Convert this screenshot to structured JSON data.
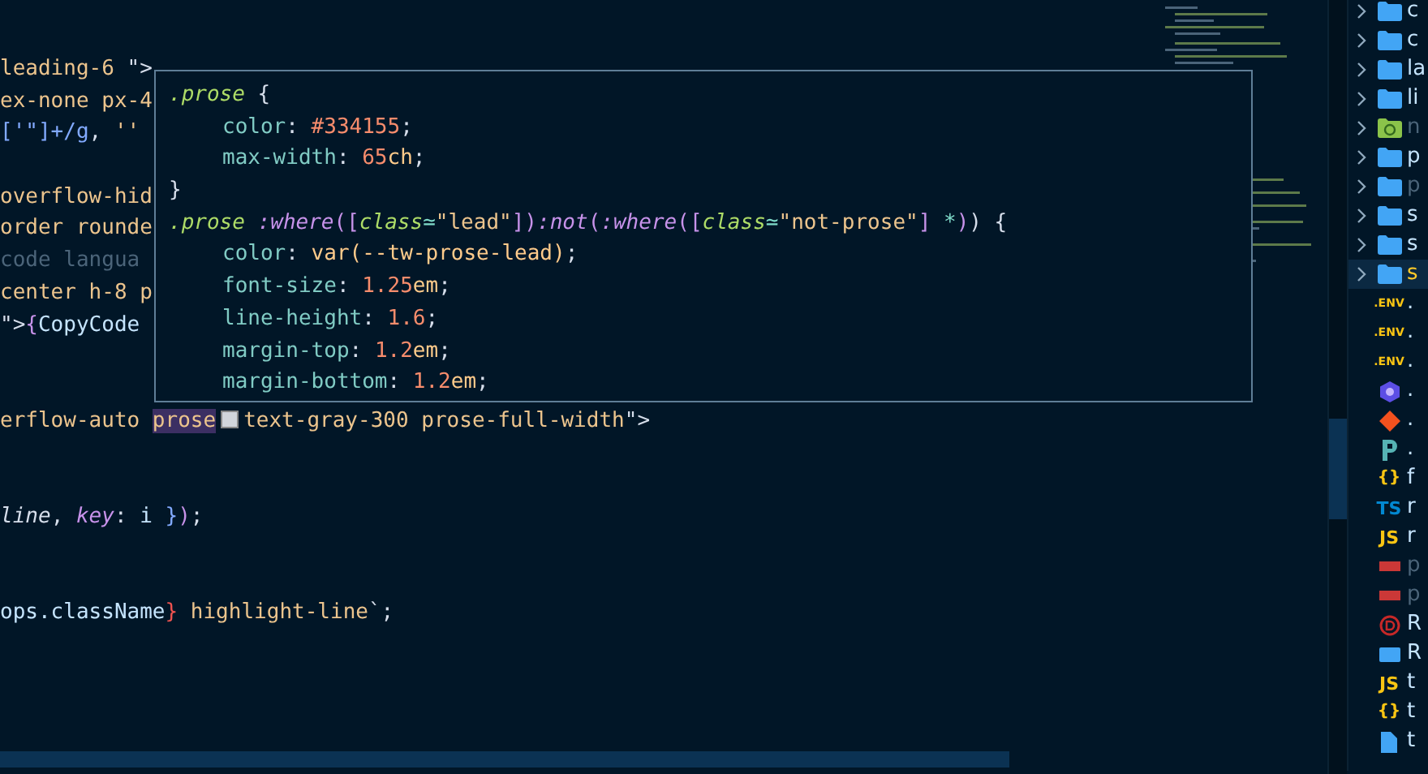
{
  "editor": {
    "lines": [
      {
        "kind": "code",
        "tokens": [
          {
            "kind": "str",
            "text": "leading-6 "
          },
          {
            "kind": "punct",
            "text": "\">"
          }
        ]
      },
      {
        "kind": "code",
        "tokens": [
          {
            "kind": "str",
            "text": "ex-none px-4"
          }
        ]
      },
      {
        "kind": "code",
        "tokens": [
          {
            "kind": "blue",
            "text": "['\"]+/g"
          },
          {
            "kind": "punct",
            "text": ", "
          },
          {
            "kind": "str",
            "text": "''"
          }
        ]
      },
      {
        "kind": "blank"
      },
      {
        "kind": "code",
        "tokens": [
          {
            "kind": "str",
            "text": "overflow-hid"
          }
        ]
      },
      {
        "kind": "code",
        "tokens": [
          {
            "kind": "str",
            "text": "order rounde"
          }
        ]
      },
      {
        "kind": "code",
        "tokens": [
          {
            "kind": "ghost",
            "text": "code langua"
          }
        ]
      },
      {
        "kind": "code",
        "tokens": [
          {
            "kind": "str",
            "text": "center h-8 p"
          }
        ]
      },
      {
        "kind": "code",
        "tokens": [
          {
            "kind": "punct",
            "text": "\">"
          },
          {
            "kind": "brace",
            "text": "{"
          },
          {
            "kind": "plain",
            "text": "CopyCode"
          }
        ]
      },
      {
        "kind": "blank"
      },
      {
        "kind": "blank"
      },
      {
        "kind": "code",
        "tokens": [
          {
            "kind": "str",
            "text": "erflow-auto "
          },
          {
            "kind": "match",
            "text": "prose"
          },
          {
            "kind": "swatch",
            "color": "#d1d5db"
          },
          {
            "kind": "str",
            "text": "text-gray-300 prose-full-width"
          },
          {
            "kind": "punct",
            "text": "\">"
          }
        ]
      },
      {
        "kind": "blank"
      },
      {
        "kind": "blank"
      },
      {
        "kind": "code",
        "tokens": [
          {
            "kind": "italic",
            "text": "line"
          },
          {
            "kind": "punct",
            "text": ", "
          },
          {
            "kind": "key",
            "text": "key"
          },
          {
            "kind": "punct",
            "text": ": "
          },
          {
            "kind": "plain",
            "text": "i "
          },
          {
            "kind": "blue",
            "text": "}"
          },
          {
            "kind": "brace",
            "text": ")"
          },
          {
            "kind": "punct",
            "text": ";"
          }
        ]
      },
      {
        "kind": "blank"
      },
      {
        "kind": "blank"
      },
      {
        "kind": "code",
        "tokens": [
          {
            "kind": "plain",
            "text": "ops.className"
          },
          {
            "kind": "red",
            "text": "}"
          },
          {
            "kind": "str",
            "text": " highlight-line"
          },
          {
            "kind": "punct",
            "text": "`;"
          }
        ]
      }
    ]
  },
  "hover": {
    "lines": [
      {
        "indented": false,
        "tokens": [
          {
            "kind": "sel",
            "text": ".prose"
          },
          {
            "kind": "punct",
            "text": " {"
          }
        ]
      },
      {
        "indented": true,
        "tokens": [
          {
            "kind": "prop",
            "text": "color"
          },
          {
            "kind": "punct",
            "text": ": "
          },
          {
            "kind": "num",
            "text": "#334155"
          },
          {
            "kind": "punct",
            "text": ";"
          }
        ]
      },
      {
        "indented": true,
        "tokens": [
          {
            "kind": "prop",
            "text": "max-width"
          },
          {
            "kind": "punct",
            "text": ": "
          },
          {
            "kind": "num",
            "text": "65"
          },
          {
            "kind": "unit",
            "text": "ch"
          },
          {
            "kind": "punct",
            "text": ";"
          }
        ]
      },
      {
        "indented": false,
        "tokens": [
          {
            "kind": "punct",
            "text": "}"
          }
        ]
      },
      {
        "indented": false,
        "tokens": [
          {
            "kind": "sel",
            "text": ".prose "
          },
          {
            "kind": "pseudo",
            "text": ":where"
          },
          {
            "kind": "brace",
            "text": "(["
          },
          {
            "kind": "attr",
            "text": "class"
          },
          {
            "kind": "op",
            "text": "≃"
          },
          {
            "kind": "lead",
            "text": "\"lead\""
          },
          {
            "kind": "brace",
            "text": "])"
          },
          {
            "kind": "pseudo",
            "text": ":not"
          },
          {
            "kind": "brace",
            "text": "("
          },
          {
            "kind": "pseudo",
            "text": ":where"
          },
          {
            "kind": "brace",
            "text": "(["
          },
          {
            "kind": "attr",
            "text": "class"
          },
          {
            "kind": "op",
            "text": "≃"
          },
          {
            "kind": "lead",
            "text": "\"not-prose\""
          },
          {
            "kind": "brace",
            "text": "] "
          },
          {
            "kind": "op",
            "text": "*"
          },
          {
            "kind": "brace",
            "text": ")"
          },
          {
            "kind": "punct",
            "text": ") {"
          }
        ]
      },
      {
        "indented": true,
        "tokens": [
          {
            "kind": "prop",
            "text": "color"
          },
          {
            "kind": "punct",
            "text": ": "
          },
          {
            "kind": "unit",
            "text": "var(--tw-prose-lead)"
          },
          {
            "kind": "punct",
            "text": ";"
          }
        ]
      },
      {
        "indented": true,
        "tokens": [
          {
            "kind": "prop",
            "text": "font-size"
          },
          {
            "kind": "punct",
            "text": ": "
          },
          {
            "kind": "num",
            "text": "1.25"
          },
          {
            "kind": "unit",
            "text": "em"
          },
          {
            "kind": "punct",
            "text": ";"
          }
        ]
      },
      {
        "indented": true,
        "tokens": [
          {
            "kind": "prop",
            "text": "line-height"
          },
          {
            "kind": "punct",
            "text": ": "
          },
          {
            "kind": "num",
            "text": "1.6"
          },
          {
            "kind": "punct",
            "text": ";"
          }
        ]
      },
      {
        "indented": true,
        "tokens": [
          {
            "kind": "prop",
            "text": "margin-top"
          },
          {
            "kind": "punct",
            "text": ": "
          },
          {
            "kind": "num",
            "text": "1.2"
          },
          {
            "kind": "unit",
            "text": "em"
          },
          {
            "kind": "punct",
            "text": ";"
          }
        ]
      },
      {
        "indented": true,
        "tokens": [
          {
            "kind": "prop",
            "text": "margin-bottom"
          },
          {
            "kind": "punct",
            "text": ": "
          },
          {
            "kind": "num",
            "text": "1.2"
          },
          {
            "kind": "unit",
            "text": "em"
          },
          {
            "kind": "punct",
            "text": ";"
          }
        ]
      }
    ]
  },
  "explorer": {
    "items": [
      {
        "kind": "folder",
        "text": "c",
        "selected": false,
        "dimmed": false
      },
      {
        "kind": "folder",
        "text": "c",
        "selected": false,
        "dimmed": false
      },
      {
        "kind": "folder",
        "text": "la",
        "selected": false,
        "dimmed": false
      },
      {
        "kind": "folder",
        "text": "li",
        "selected": false,
        "dimmed": false
      },
      {
        "kind": "folder-node",
        "text": "n",
        "selected": false,
        "dimmed": true
      },
      {
        "kind": "folder",
        "text": "p",
        "selected": false,
        "dimmed": false
      },
      {
        "kind": "folder",
        "text": "p",
        "selected": false,
        "dimmed": true
      },
      {
        "kind": "folder",
        "text": "s",
        "selected": false,
        "dimmed": false
      },
      {
        "kind": "folder",
        "text": "s",
        "selected": false,
        "dimmed": false
      },
      {
        "kind": "folder",
        "text": "s",
        "selected": true,
        "dimmed": false
      },
      {
        "kind": "env",
        "icon_label": ".ENV",
        "text": ".",
        "selected": false,
        "dimmed": false
      },
      {
        "kind": "env",
        "icon_label": ".ENV",
        "text": ".",
        "selected": false,
        "dimmed": false
      },
      {
        "kind": "env",
        "icon_label": ".ENV",
        "text": ".",
        "selected": false,
        "dimmed": false
      },
      {
        "kind": "hex",
        "text": ".",
        "selected": false,
        "dimmed": false
      },
      {
        "kind": "git",
        "text": ".",
        "selected": false,
        "dimmed": false
      },
      {
        "kind": "prettier",
        "text": ".",
        "selected": false,
        "dimmed": false
      },
      {
        "kind": "json",
        "icon_label": "{}",
        "text": "f",
        "selected": false,
        "dimmed": false
      },
      {
        "kind": "ts",
        "icon_label": "TS",
        "text": "r",
        "selected": false,
        "dimmed": false
      },
      {
        "kind": "js",
        "icon_label": "JS",
        "text": "r",
        "selected": false,
        "dimmed": false
      },
      {
        "kind": "npm",
        "text": "p",
        "selected": false,
        "dimmed": true
      },
      {
        "kind": "npm",
        "text": "p",
        "selected": false,
        "dimmed": true
      },
      {
        "kind": "d",
        "text": "R",
        "selected": false,
        "dimmed": false
      },
      {
        "kind": "md",
        "text": "R",
        "selected": false,
        "dimmed": false
      },
      {
        "kind": "js",
        "icon_label": "JS",
        "text": "t",
        "selected": false,
        "dimmed": false
      },
      {
        "kind": "json",
        "icon_label": "{}",
        "text": "t",
        "selected": false,
        "dimmed": false
      },
      {
        "kind": "file",
        "text": "t",
        "selected": false,
        "dimmed": false
      }
    ]
  }
}
